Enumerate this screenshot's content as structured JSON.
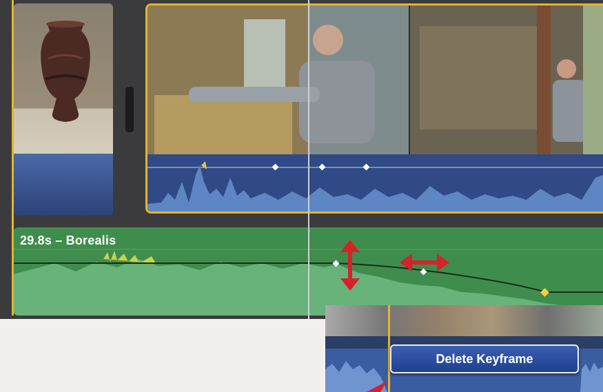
{
  "background_clip": {
    "title": "29.8s – Borealis"
  },
  "context_menu": {
    "delete_keyframe_label": "Delete Keyframe"
  },
  "colors": {
    "selection_outline": "#e3b52e",
    "background_audio": "#3f8d4c",
    "audio_waveform_blue": "#2f4a86",
    "annotation_arrow": "#d7212b",
    "keyframe_selected": "#f0d24a"
  },
  "icons": {
    "vertical_arrow": "volume-adjust-arrow-icon",
    "horizontal_arrow": "keyframe-move-arrow-icon"
  }
}
